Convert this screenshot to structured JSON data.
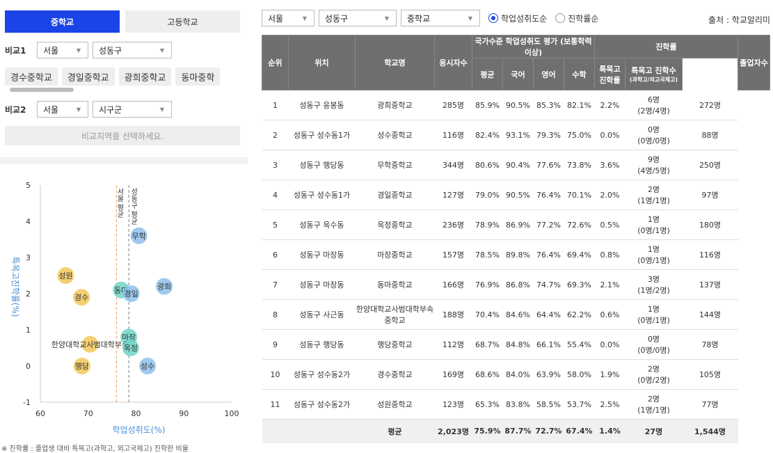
{
  "tabs": {
    "middle": "중학교",
    "high": "고등학교"
  },
  "compare1": {
    "label": "비교1",
    "city": "서울",
    "district": "성동구"
  },
  "chips": [
    "경수중학교",
    "경일중학교",
    "광희중학교",
    "동마중학"
  ],
  "compare2": {
    "label": "비교2",
    "city": "서울",
    "district": "시구군"
  },
  "pick_region": "비교지역을 선택하세요.",
  "chart_data": {
    "type": "scatter",
    "xlabel": "학업성취도(%)",
    "ylabel": "특목고진학률(%)",
    "xlim": [
      60,
      100
    ],
    "ylim": [
      -1,
      5
    ],
    "xticks": [
      60,
      70,
      80,
      90,
      100
    ],
    "yticks": [
      -1,
      0,
      1,
      2,
      3,
      4,
      5
    ],
    "avg_lines": [
      {
        "x": 75.9,
        "label": "서울 평균",
        "color": "#e89a55"
      },
      {
        "x": 78.5,
        "label": "성동구 평균",
        "color": "#6f7f92"
      }
    ],
    "points": [
      {
        "name": "무학",
        "x": 80.6,
        "y": 3.6,
        "color": "#8fc0ea"
      },
      {
        "name": "광희",
        "x": 85.9,
        "y": 2.2,
        "color": "#8fc0ea"
      },
      {
        "name": "동마",
        "x": 76.9,
        "y": 2.1,
        "color": "#6fd6c8"
      },
      {
        "name": "경일",
        "x": 79.0,
        "y": 2.0,
        "color": "#8fc0ea"
      },
      {
        "name": "성원",
        "x": 65.3,
        "y": 2.5,
        "color": "#f2c85a"
      },
      {
        "name": "경수",
        "x": 68.6,
        "y": 1.9,
        "color": "#f2c85a"
      },
      {
        "name": "마장",
        "x": 78.5,
        "y": 0.8,
        "color": "#6fd6c8"
      },
      {
        "name": "한양대학교사범대학부속",
        "x": 70.4,
        "y": 0.6,
        "color": "#f2c85a"
      },
      {
        "name": "옥정",
        "x": 78.9,
        "y": 0.5,
        "color": "#6fd6c8"
      },
      {
        "name": "행당",
        "x": 68.7,
        "y": 0.0,
        "color": "#f2c85a"
      },
      {
        "name": "성수",
        "x": 82.4,
        "y": 0.0,
        "color": "#8fc0ea"
      }
    ]
  },
  "footnote": "※ 진학률 : 졸업생 대비 특목고(과학고, 외고국제고) 진학한 비율",
  "filters": {
    "city": "서울",
    "district": "성동구",
    "level": "중학교",
    "sort1": "학업성취도순",
    "sort2": "진학률순"
  },
  "source": "출처 : 학교알리미",
  "table": {
    "group1": "국가수준 학업성취도 평가 (보통학력이상)",
    "group2": "진학률",
    "headers": [
      "순위",
      "위치",
      "학교명",
      "응시자수",
      "평균",
      "국어",
      "영어",
      "수학",
      "특목고 진학률",
      "특목고 진학수",
      "(과학고/외고국제고)",
      "졸업자수"
    ],
    "rows": [
      [
        "1",
        "성동구 응봉동",
        "광희중학교",
        "285명",
        "85.9%",
        "90.5%",
        "85.3%",
        "82.1%",
        "2.2%",
        "6명",
        "(2명/4명)",
        "272명"
      ],
      [
        "2",
        "성동구 성수동1가",
        "성수중학교",
        "116명",
        "82.4%",
        "93.1%",
        "79.3%",
        "75.0%",
        "0.0%",
        "0명",
        "(0명/0명)",
        "88명"
      ],
      [
        "3",
        "성동구 행당동",
        "무학중학교",
        "344명",
        "80.6%",
        "90.4%",
        "77.6%",
        "73.8%",
        "3.6%",
        "9명",
        "(4명/5명)",
        "250명"
      ],
      [
        "4",
        "성동구 성수동1가",
        "경일중학교",
        "127명",
        "79.0%",
        "90.5%",
        "76.4%",
        "70.1%",
        "2.0%",
        "2명",
        "(1명/1명)",
        "97명"
      ],
      [
        "5",
        "성동구 옥수동",
        "옥정중학교",
        "236명",
        "78.9%",
        "86.9%",
        "77.2%",
        "72.6%",
        "0.5%",
        "1명",
        "(0명/1명)",
        "180명"
      ],
      [
        "6",
        "성동구 마장동",
        "마장중학교",
        "157명",
        "78.5%",
        "89.8%",
        "76.4%",
        "69.4%",
        "0.8%",
        "1명",
        "(0명/1명)",
        "116명"
      ],
      [
        "7",
        "성동구 마장동",
        "동마중학교",
        "166명",
        "76.9%",
        "86.8%",
        "74.7%",
        "69.3%",
        "2.1%",
        "3명",
        "(1명/2명)",
        "137명"
      ],
      [
        "8",
        "성동구 사근동",
        "한양대학교사범대학부속중학교",
        "188명",
        "70.4%",
        "84.6%",
        "64.4%",
        "62.2%",
        "0.6%",
        "1명",
        "(0명/1명)",
        "144명"
      ],
      [
        "9",
        "성동구 행당동",
        "행당중학교",
        "112명",
        "68.7%",
        "84.8%",
        "66.1%",
        "55.4%",
        "0.0%",
        "0명",
        "(0명/0명)",
        "78명"
      ],
      [
        "10",
        "성동구 성수동2가",
        "경수중학교",
        "169명",
        "68.6%",
        "84.0%",
        "63.9%",
        "58.0%",
        "1.9%",
        "2명",
        "(0명/2명)",
        "105명"
      ],
      [
        "11",
        "성동구 성수동2가",
        "성원중학교",
        "123명",
        "65.3%",
        "83.8%",
        "58.5%",
        "53.7%",
        "2.5%",
        "2명",
        "(1명/1명)",
        "77명"
      ]
    ],
    "average": [
      "",
      "",
      "평균",
      "2,023명",
      "75.9%",
      "87.7%",
      "72.7%",
      "67.4%",
      "1.4%",
      "27명",
      "",
      "1,544명"
    ]
  }
}
